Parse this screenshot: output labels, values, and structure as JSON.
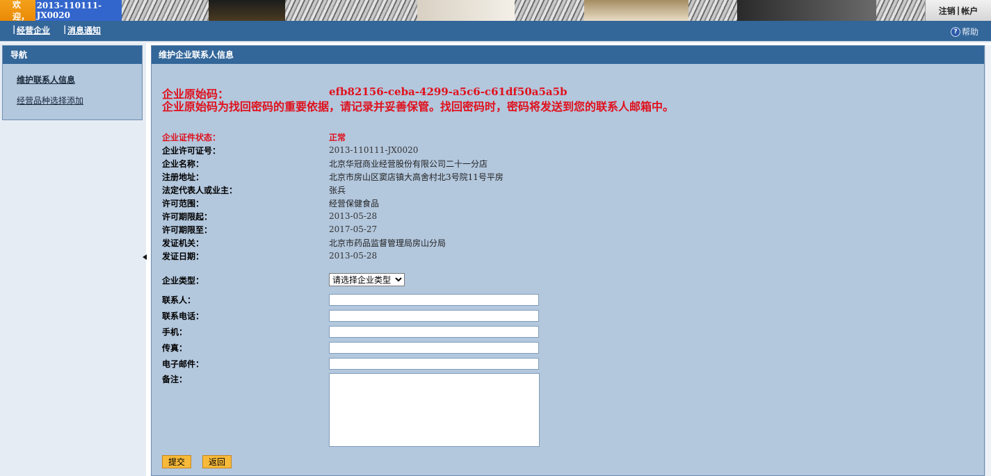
{
  "header": {
    "welcome_text": "欢迎，",
    "user_id": "2013-110111-JX0020",
    "logout": "注销",
    "separator": "|",
    "account": "帐户"
  },
  "menu": {
    "items": [
      {
        "label": "经营企业"
      },
      {
        "label": "消息通知"
      }
    ],
    "pipe": "|",
    "help": "帮助",
    "help_icon": "?"
  },
  "nav": {
    "title": "导航",
    "items": [
      {
        "label": "维护联系人信息",
        "active": true
      },
      {
        "label": "经营品种选择添加",
        "active": false
      }
    ]
  },
  "main": {
    "title": "维护企业联系人信息",
    "origin_code_label": "企业原始码：",
    "origin_code_value": "efb82156-ceba-4299-a5c6-c61df50a5a5b",
    "notice": "企业原始码为找回密码的重要依据，请记录并妥善保管。找回密码时，密码将发送到您的联系人邮箱中。",
    "info": [
      {
        "label": "企业证件状态：",
        "value": "正常",
        "highlight": true
      },
      {
        "label": "企业许可证号：",
        "value": "2013-110111-JX0020"
      },
      {
        "label": "企业名称：",
        "value": "北京华冠商业经营股份有限公司二十一分店"
      },
      {
        "label": "注册地址：",
        "value": "北京市房山区窦店镇大高舍村北3号院11号平房"
      },
      {
        "label": "法定代表人或业主：",
        "value": "张兵"
      },
      {
        "label": "许可范围：",
        "value": "经营保健食品"
      },
      {
        "label": "许可期限起：",
        "value": "2013-05-28"
      },
      {
        "label": "许可期限至：",
        "value": "2017-05-27"
      },
      {
        "label": "发证机关：",
        "value": "北京市药品监督管理局房山分局"
      },
      {
        "label": "发证日期：",
        "value": "2013-05-28"
      }
    ],
    "form": {
      "type_label": "企业类型：",
      "type_selected": "请选择企业类型",
      "contact_label": "联系人：",
      "phone_label": "联系电话：",
      "mobile_label": "手机：",
      "fax_label": "传真：",
      "email_label": "电子邮件：",
      "remark_label": "备注：",
      "contact_value": "",
      "phone_value": "",
      "mobile_value": "",
      "fax_value": "",
      "email_value": "",
      "remark_value": ""
    },
    "buttons": {
      "submit": "提交",
      "back": "返回"
    }
  },
  "colors": {
    "header_blue": "#336699",
    "panel_bg": "#b3c7dd",
    "alert_red": "#e0101c",
    "welcome_orange": "#f4a01a",
    "button_orange": "#f7b93a"
  }
}
